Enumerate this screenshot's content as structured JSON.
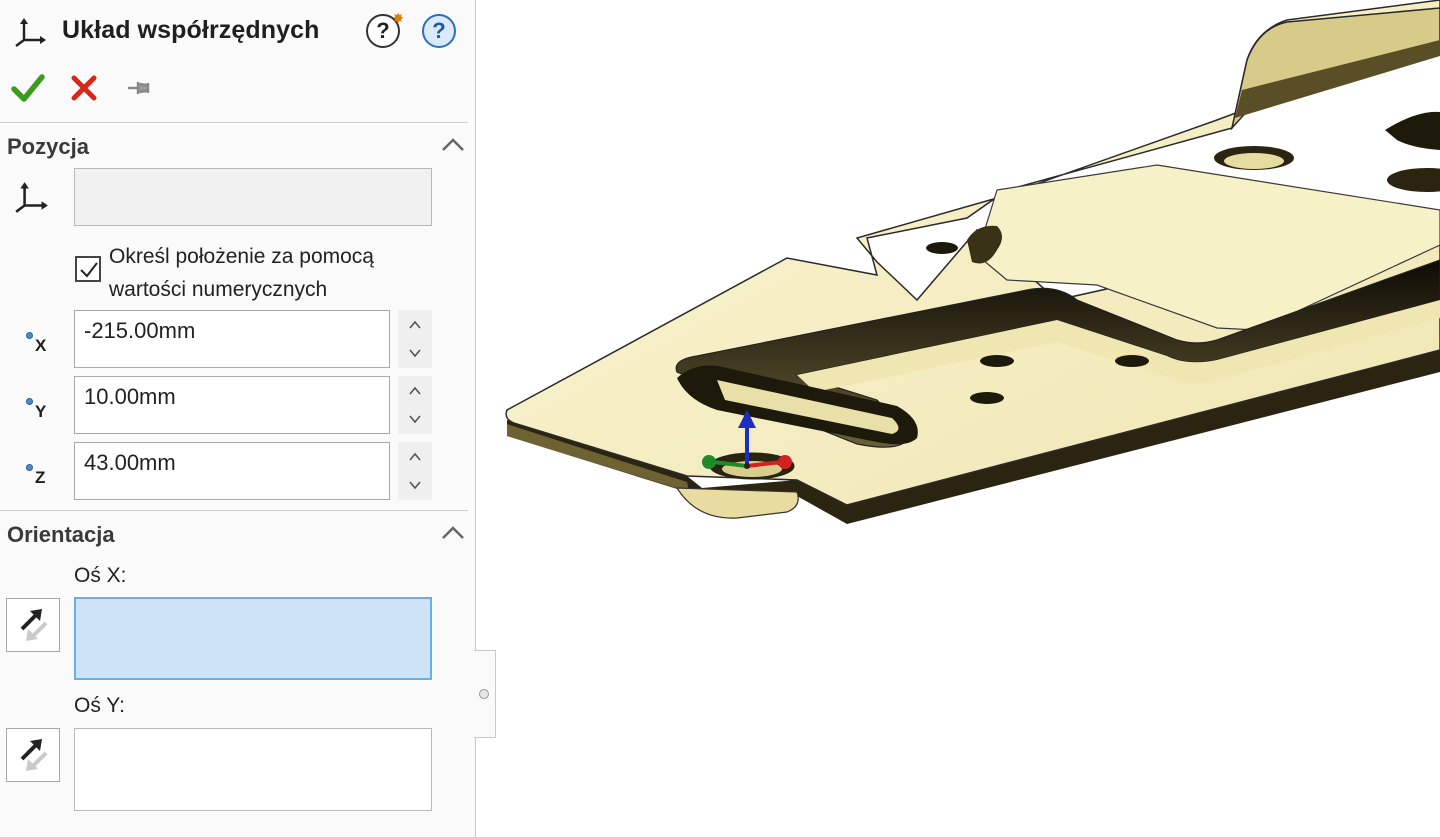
{
  "panel": {
    "title": "Układ współrzędnych",
    "help_whats_wrong": "?",
    "help": "?",
    "position_section": {
      "title": "Pozycja",
      "checkbox_checked": true,
      "checkbox_label": "Określ położenie za pomocą wartości numerycznych",
      "x_label": "X",
      "x_value": "-215.00mm",
      "y_label": "Y",
      "y_value": "10.00mm",
      "z_label": "Z",
      "z_value": "43.00mm"
    },
    "orientation_section": {
      "title": "Orientacja",
      "x_axis_label": "Oś X:",
      "y_axis_label": "Oś Y:"
    }
  },
  "colors": {
    "ok": "#3a9b1e",
    "cancel": "#d8261b",
    "active_selection": "#cfe3f6",
    "part_face": "#f6efc0",
    "triad_x": "#d42020",
    "triad_y": "#1f8a2a",
    "triad_z": "#1d2fbf"
  },
  "icons": [
    "coordinate-system-icon",
    "whats-wrong-icon",
    "help-icon",
    "ok-check-icon",
    "cancel-x-icon",
    "pushpin-icon",
    "collapse-chevron-icon",
    "reverse-direction-icon"
  ]
}
